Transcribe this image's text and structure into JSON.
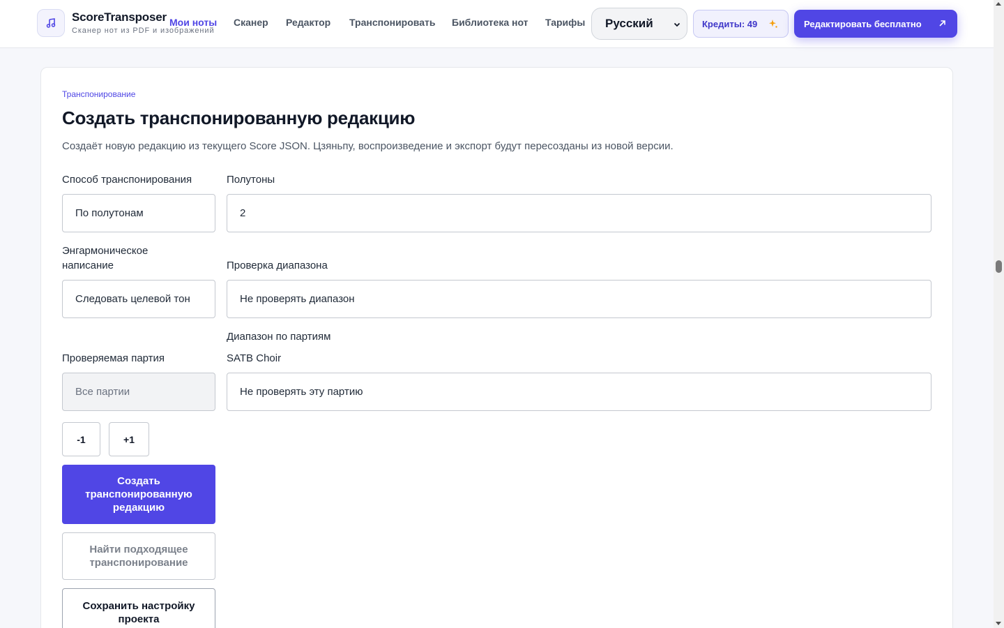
{
  "header": {
    "brand_name": "ScoreTransposer",
    "brand_tagline": "Сканер нот из PDF и изображений",
    "logo_icon": "music-note-icon",
    "nav": [
      {
        "label": "Мои ноты",
        "active": true
      },
      {
        "label": "Сканер",
        "active": false
      },
      {
        "label": "Редактор",
        "active": false
      },
      {
        "label": "Транспонировать",
        "active": false
      },
      {
        "label": "Библиотека нот",
        "active": false
      },
      {
        "label": "Тарифы",
        "active": false
      }
    ],
    "language": "Русский",
    "credits_label": "Кредиты: 49",
    "cta_label": "Редактировать бесплатно"
  },
  "colors": {
    "accent": "#5046e5",
    "accent_light": "#f1f1fd",
    "text": "#111827",
    "muted": "#4b5563"
  },
  "main": {
    "breadcrumb": "Транспонирование",
    "title": "Создать транспонированную редакцию",
    "description": "Создаёт новую редакцию из текущего Score JSON. Цзяньпу, воспроизведение и экспорт будут пересозданы из новой версии.",
    "method": {
      "label": "Способ транспонирования",
      "value": "По полутонам"
    },
    "semitones": {
      "label": "Полутоны",
      "value": "2"
    },
    "enharmonic": {
      "label": "Энгармоническое написание",
      "value": "Следовать целевой тон"
    },
    "range_check": {
      "label": "Проверка диапазона",
      "value": "Не проверять диапазон"
    },
    "part_ranges_label": "Диапазон по партиям",
    "checked_part": {
      "label": "Проверяемая партия",
      "value": "Все партии"
    },
    "part": {
      "name": "SATB Choir",
      "value": "Не проверять эту партию"
    },
    "step_down": "-1",
    "step_up": "+1",
    "create_button": "Создать транспонированную редакцию",
    "find_button": "Найти подходящее транспонирование",
    "save_button": "Сохранить настройку проекта"
  }
}
